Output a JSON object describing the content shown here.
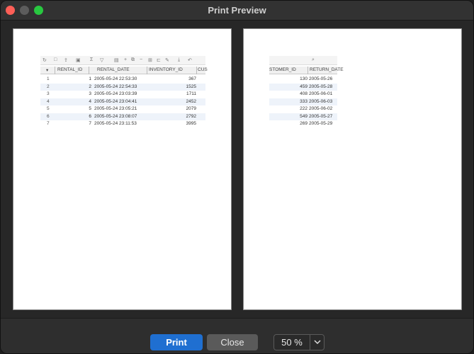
{
  "window": {
    "title": "Print Preview"
  },
  "page1": {
    "toolbar_icons": [
      "refresh-icon",
      "stop-icon",
      "export-icon",
      "save-icon",
      "sum-icon",
      "filter-icon",
      "panel-icon",
      "add-row-icon",
      "copy-row-icon",
      "delete-row-icon",
      "grid-icon",
      "text-icon",
      "edit-icon",
      "download-icon",
      "undo-icon"
    ],
    "columns": [
      "RENTAL_ID",
      "RENTAL_DATE",
      "INVENTORY_ID",
      "CUS"
    ],
    "rows": [
      {
        "num": "1",
        "rental_id": "1",
        "date": "2005-05-24 22:53:30",
        "inventory": "367"
      },
      {
        "num": "2",
        "rental_id": "2",
        "date": "2005-05-24 22:54:33",
        "inventory": "1525"
      },
      {
        "num": "3",
        "rental_id": "3",
        "date": "2005-05-24 23:03:39",
        "inventory": "1711"
      },
      {
        "num": "4",
        "rental_id": "4",
        "date": "2005-05-24 23:04:41",
        "inventory": "2452"
      },
      {
        "num": "5",
        "rental_id": "5",
        "date": "2005-05-24 23:05:21",
        "inventory": "2079"
      },
      {
        "num": "6",
        "rental_id": "6",
        "date": "2005-05-24 23:08:07",
        "inventory": "2792"
      },
      {
        "num": "7",
        "rental_id": "7",
        "date": "2005-05-24 23:11:53",
        "inventory": "3995"
      }
    ]
  },
  "page2": {
    "columns": [
      "STOMER_ID",
      "RETURN_DATE"
    ],
    "rows": [
      {
        "c1": "130",
        "c2": "2005-05-26"
      },
      {
        "c1": "459",
        "c2": "2005-05-28"
      },
      {
        "c1": "408",
        "c2": "2005-06-01"
      },
      {
        "c1": "333",
        "c2": "2005-06-03"
      },
      {
        "c1": "222",
        "c2": "2005-06-02"
      },
      {
        "c1": "549",
        "c2": "2005-05-27"
      },
      {
        "c1": "269",
        "c2": "2005-05-29"
      }
    ]
  },
  "buttons": {
    "print": "Print",
    "close": "Close"
  },
  "zoom": {
    "value": "50 %"
  }
}
